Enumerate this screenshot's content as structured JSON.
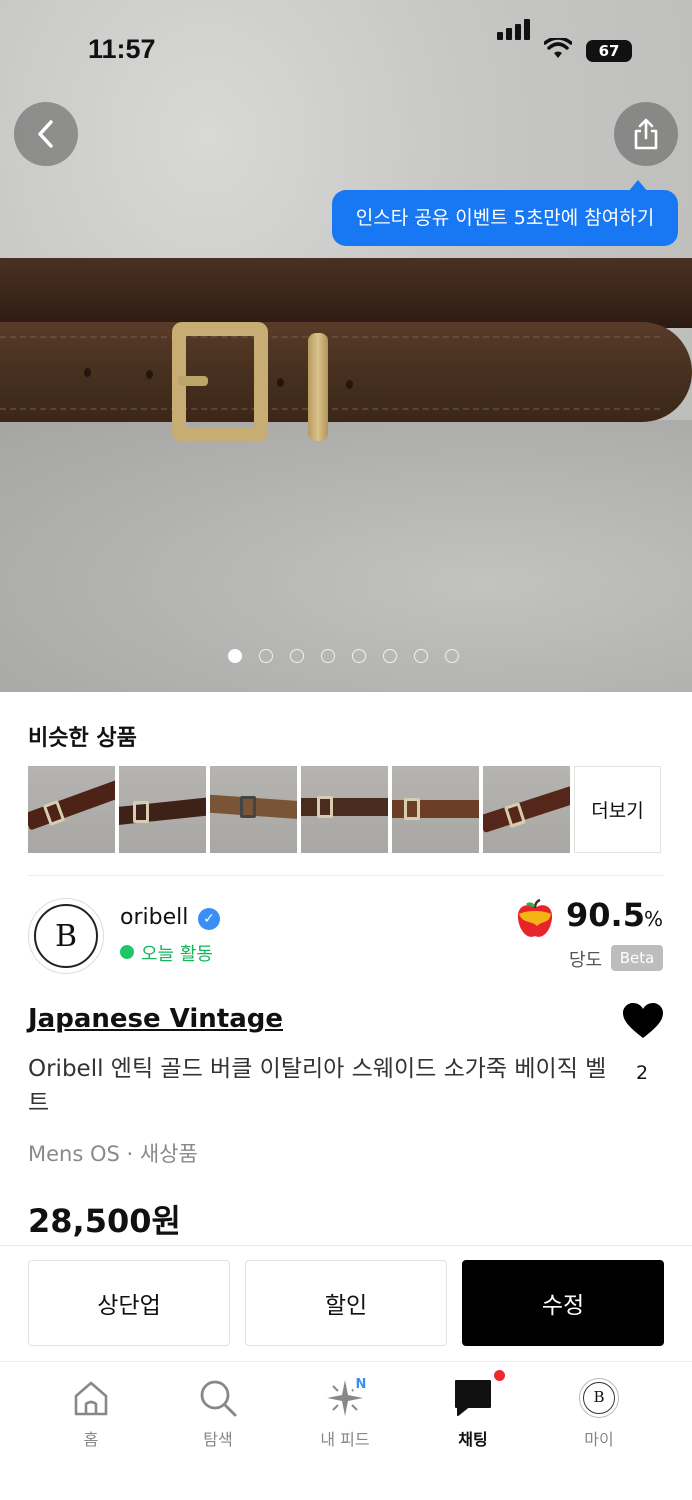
{
  "status_bar": {
    "time": "11:57",
    "battery": "67"
  },
  "hero": {
    "tooltip": "인스타 공유 이벤트 5초만에 참여하기",
    "image_count": 8,
    "active_index": 0
  },
  "similar": {
    "title": "비슷한 상품",
    "more_label": "더보기"
  },
  "seller": {
    "name": "oribell",
    "avatar_letter": "B",
    "activity": "오늘 활동",
    "score": "90.5",
    "score_unit": "%",
    "score_label": "당도",
    "beta_label": "Beta"
  },
  "product": {
    "brand": "Japanese Vintage",
    "title": "Oribell 엔틱 골드 버클 이탈리아 스웨이드 소가죽 베이직 벨트",
    "likes": "2",
    "meta": "Mens OS · 새상품",
    "price": "28,500원"
  },
  "actions": {
    "bump": "상단업",
    "discount": "할인",
    "edit": "수정"
  },
  "tabbar": {
    "home": "홈",
    "search": "탐색",
    "feed": "내 피드",
    "feed_badge": "N",
    "chat": "채팅",
    "my": "마이"
  },
  "colors": {
    "accent_blue": "#1877f2",
    "online_green": "#1ec765",
    "notification_red": "#f0282d"
  }
}
